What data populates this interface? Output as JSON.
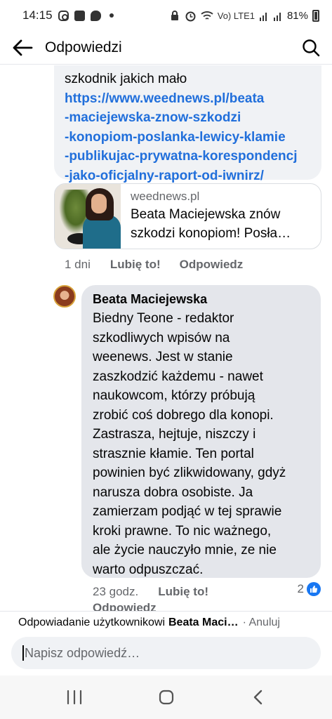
{
  "status_bar": {
    "time": "14:15",
    "left_icons": [
      "instagram-icon",
      "gallery-icon",
      "chat-icon",
      "notification-dot-icon"
    ],
    "right_icons": [
      "alarm-lock-icon",
      "alarm-icon",
      "wifi-icon",
      "signal-icon",
      "signal-icon-2",
      "battery-icon"
    ],
    "volte_label": "Vo) LTE1",
    "battery": "81%"
  },
  "header": {
    "title": "Odpowiedzi",
    "back_icon": "arrow-left-icon",
    "search_icon": "search-icon"
  },
  "top_comment": {
    "text_tail": "szkodnik jakich mało",
    "link_lines": [
      "https://www.weednews.pl/beata",
      "-maciejewska-znow-szkodzi",
      "-konopiom-poslanka-lewicy-klamie",
      "-publikujac-prywatna-korespondencj",
      "-jako-oficjalny-raport-od-iwnirz/"
    ],
    "link_preview": {
      "domain": "weednews.pl",
      "title": "Beata Maciejewska znów szkodzi konopiom! Posła…"
    },
    "age": "1 dni",
    "like_label": "Lubię to!",
    "reply_label": "Odpowiedz"
  },
  "reply_comment": {
    "author": "Beata Maciejewska",
    "lines": [
      "Biedny Teone - redaktor",
      "szkodliwych wpisów na",
      "weenews.  Jest w stanie",
      "zaszkodzić każdemu - nawet",
      "naukowcom, którzy próbują",
      "zrobić coś dobrego dla konopi.",
      "Zastrasza, hejtuje, niszczy i",
      "strasznie kłamie. Ten  portal",
      "powinien być zlikwidowany, gdyż",
      "narusza dobra osobiste. Ja",
      "zamierzam podjąć w tej sprawie",
      "kroki prawne. To nic ważnego,",
      "ale życie nauczyło mnie, ze nie",
      "warto odpuszczać."
    ],
    "age": "23 godz.",
    "like_label": "Lubię to!",
    "reply_label": "Odpowiedz",
    "reaction_count": "2",
    "reaction_icon": "like-icon"
  },
  "reply_bar": {
    "prefix": "Odpowiadanie użytkownikowi",
    "name": "Beata Maci…",
    "cancel": "· Anuluj"
  },
  "composer": {
    "placeholder": "Napisz odpowiedź…"
  },
  "nav": {
    "icons": [
      "recent-apps-icon",
      "home-icon",
      "back-icon"
    ]
  },
  "colors": {
    "link": "#216fdb",
    "bubble": "#e4e6eb",
    "bubble_light": "#f0f2f5",
    "secondary_text": "#65676b",
    "like_badge": "#1877f2"
  }
}
